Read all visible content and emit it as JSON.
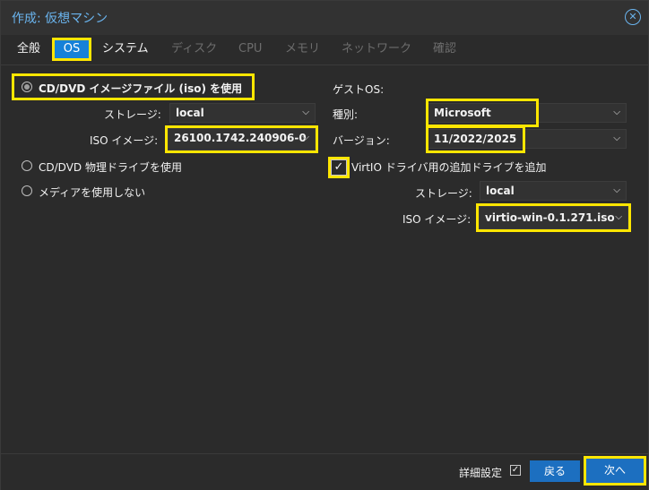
{
  "window": {
    "title": "作成: 仮想マシン",
    "close_icon": "close-circle-icon"
  },
  "tabs": [
    {
      "label": "全般",
      "state": "enabled"
    },
    {
      "label": "OS",
      "state": "active"
    },
    {
      "label": "システム",
      "state": "enabled"
    },
    {
      "label": "ディスク",
      "state": "disabled"
    },
    {
      "label": "CPU",
      "state": "disabled"
    },
    {
      "label": "メモリ",
      "state": "disabled"
    },
    {
      "label": "ネットワーク",
      "state": "disabled"
    },
    {
      "label": "確認",
      "state": "disabled"
    }
  ],
  "left": {
    "option_iso": "CD/DVD イメージファイル (iso) を使用",
    "storage_label": "ストレージ:",
    "storage_value": "local",
    "iso_label": "ISO イメージ:",
    "iso_value": "26100.1742.240906-0",
    "option_physical": "CD/DVD 物理ドライブを使用",
    "option_none": "メディアを使用しない"
  },
  "right": {
    "guest_os_label": "ゲストOS:",
    "type_label": "種別:",
    "type_value": "Microsoft Windows",
    "version_label": "バージョン:",
    "version_value": "11/2022/2025",
    "virtio_label": "VirtIO ドライバ用の追加ドライブを追加",
    "virtio_checked": true,
    "storage_label": "ストレージ:",
    "storage_value": "local",
    "iso_label": "ISO イメージ:",
    "iso_value": "virtio-win-0.1.271.iso"
  },
  "footer": {
    "advanced_label": "詳細設定",
    "advanced_checked": true,
    "back_label": "戻る",
    "next_label": "次へ"
  },
  "colors": {
    "accent": "#1681d8",
    "highlight": "#ffe600",
    "title": "#6ab4ee"
  }
}
